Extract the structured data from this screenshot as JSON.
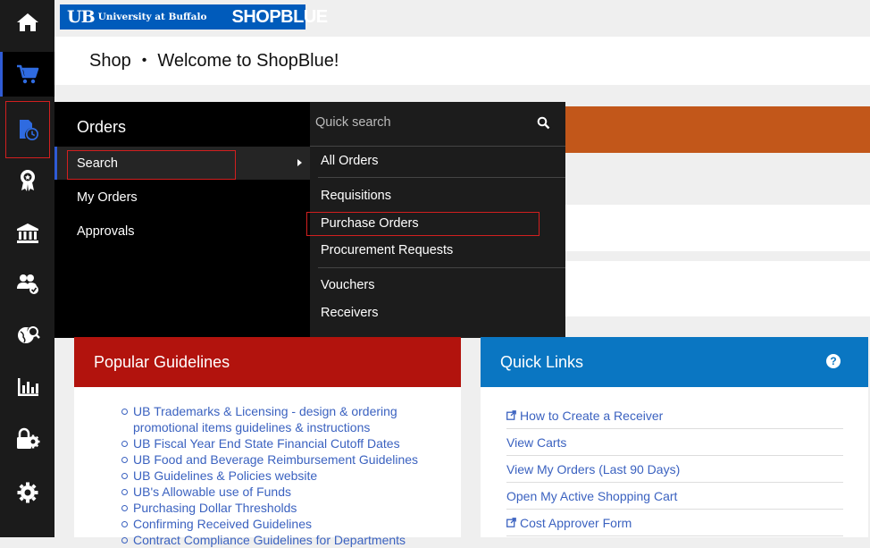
{
  "header": {
    "logo_ub": "UB",
    "logo_university": "University at Buffalo",
    "logo_brand": "SHOPBLUE",
    "breadcrumb_shop": "Shop",
    "breadcrumb_sep": "•",
    "breadcrumb_page": "Welcome to ShopBlue!"
  },
  "left_nav": {
    "items": [
      {
        "icon": "home-icon"
      },
      {
        "icon": "cart-icon"
      },
      {
        "icon": "orders-clock-icon"
      },
      {
        "icon": "award-ribbon-icon"
      },
      {
        "icon": "bank-icon"
      },
      {
        "icon": "users-check-icon"
      },
      {
        "icon": "globe-search-icon"
      },
      {
        "icon": "bar-chart-icon"
      },
      {
        "icon": "lock-gear-icon"
      },
      {
        "icon": "gear-icon"
      }
    ]
  },
  "menu": {
    "title": "Orders",
    "items": [
      "Search",
      "My Orders",
      "Approvals"
    ],
    "quick_search_placeholder": "Quick search",
    "sub_items": [
      "All Orders",
      "Requisitions",
      "Purchase Orders",
      "Procurement Requests",
      "Vouchers",
      "Receivers"
    ]
  },
  "popular_guidelines": {
    "title": "Popular Guidelines",
    "links": [
      "UB Trademarks & Licensing - design & ordering promotional items guidelines & instructions",
      "UB Fiscal Year End State Financial Cutoff Dates",
      "UB Food and Beverage Reimbursement Guidelines",
      "UB Guidelines & Policies website",
      "UB's Allowable use of Funds",
      "Purchasing Dollar Thresholds",
      "Confirming Received Guidelines",
      "Contract Compliance Guidelines for Departments"
    ]
  },
  "quick_links": {
    "title": "Quick Links",
    "help": "?",
    "links": [
      {
        "label": "How to Create a Receiver",
        "external": true
      },
      {
        "label": "View Carts",
        "external": false
      },
      {
        "label": "View My Orders (Last 90 Days)",
        "external": false
      },
      {
        "label": "Open My Active Shopping Cart",
        "external": false
      },
      {
        "label": "Cost Approver Form",
        "external": true
      }
    ]
  },
  "colors": {
    "accent_blue": "#2f5bd6",
    "guidelines_red": "#b2130d",
    "quick_links_blue": "#0a76c2",
    "orange": "#c2571a"
  }
}
